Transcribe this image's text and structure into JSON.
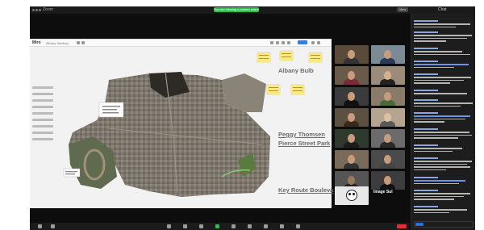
{
  "window": {
    "app_title": "Zoom",
    "share_status": "You are viewing a screen share",
    "view_label": "View"
  },
  "chat": {
    "title": "Chat"
  },
  "shared_screen": {
    "doc_title": "Miro",
    "doc_subtitle": "Albany Sanitary",
    "labels": {
      "albany_bulb": "Albany Bulb",
      "peggy_thomsen": "Peggy Thomsen",
      "pierce_street_park": "Pierce Street Park",
      "key_route": "Key Route Bouleva"
    }
  },
  "gallery": {
    "pinned_name": "Image Sul"
  },
  "colors": {
    "accent_green": "#2fbf4a",
    "end_red": "#d9342b",
    "sticky": "#fbe97a",
    "link_blue": "#6b93e6"
  }
}
